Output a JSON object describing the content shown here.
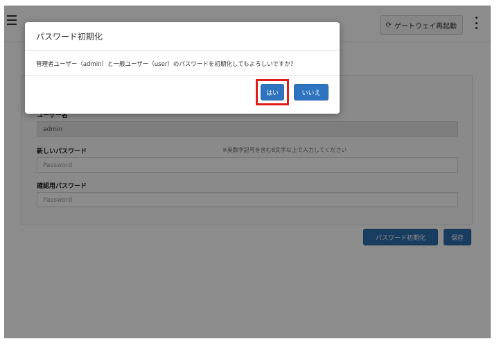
{
  "topbar": {
    "gateway_button_icon": "refresh-icon",
    "gateway_button_label": "ゲートウェイ再起動",
    "menu_icon": "hamburger-icon",
    "more_icon": "kebab-icon"
  },
  "form": {
    "username_label": "ユーザー名",
    "username_value": "admin",
    "new_password_label": "新しいパスワード",
    "new_password_placeholder": "Password",
    "new_password_hint": "※英数字記号を含む8文字以上で入力してください",
    "confirm_password_label": "確認用パスワード",
    "confirm_password_placeholder": "Password"
  },
  "actions": {
    "reset_password_label": "パスワード初期化",
    "save_label": "保存"
  },
  "modal": {
    "title": "パスワード初期化",
    "message": "管理者ユーザー（admin）と一般ユーザー（user）のパスワードを初期化してもよろしいですか？",
    "yes_label": "はい",
    "no_label": "いいえ"
  },
  "colors": {
    "primary": "#2f74c0",
    "highlight": "#e41b1b",
    "overlay": "rgba(0,0,0,0.45)"
  }
}
